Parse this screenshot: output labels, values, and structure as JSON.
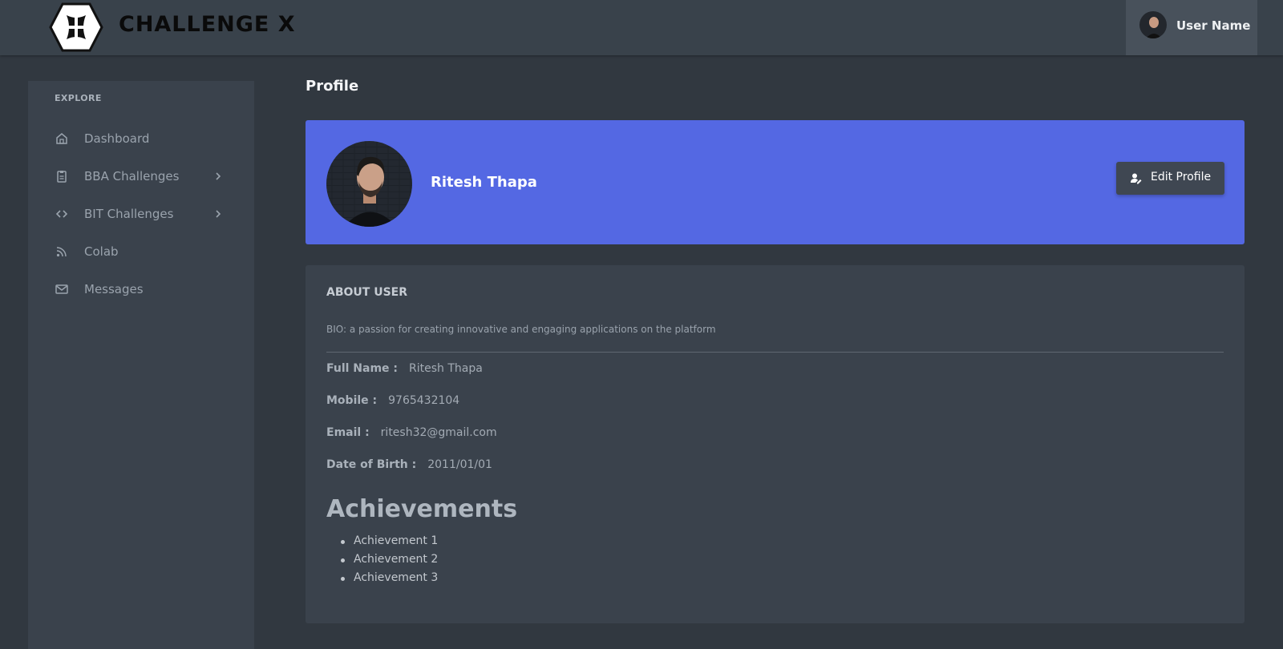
{
  "header": {
    "app_name": "CHALLENGE X",
    "logo_icon": "hexagon-cross-logo",
    "user_name": "User Name"
  },
  "sidebar": {
    "section_label": "EXPLORE",
    "items": [
      {
        "label": "Dashboard",
        "icon": "home-icon",
        "has_chevron": false
      },
      {
        "label": "BBA Challenges",
        "icon": "clipboard-icon",
        "has_chevron": true
      },
      {
        "label": "BIT Challenges",
        "icon": "code-icon",
        "has_chevron": true
      },
      {
        "label": "Colab",
        "icon": "rss-icon",
        "has_chevron": false
      },
      {
        "label": "Messages",
        "icon": "mail-icon",
        "has_chevron": false
      }
    ]
  },
  "main": {
    "page_title": "Profile",
    "profile": {
      "name": "Ritesh Thapa",
      "edit_button": "Edit Profile"
    },
    "about": {
      "title": "ABOUT USER",
      "bio": "BIO: a passion for creating innovative and engaging applications on the platform",
      "fields": [
        {
          "label": "Full Name :",
          "value": "Ritesh Thapa"
        },
        {
          "label": "Mobile :",
          "value": "9765432104"
        },
        {
          "label": "Email :",
          "value": "ritesh32@gmail.com"
        },
        {
          "label": "Date of Birth :",
          "value": "2011/01/01"
        }
      ],
      "achievements_title": "Achievements",
      "achievements": [
        "Achievement 1",
        "Achievement 2",
        "Achievement 3"
      ]
    }
  },
  "colors": {
    "page_bg": "#313840",
    "topbar_bg": "#39424b",
    "sidebar_bg": "#3a424c",
    "profile_card_bg": "#5468e3",
    "button_bg": "#3f4752"
  }
}
